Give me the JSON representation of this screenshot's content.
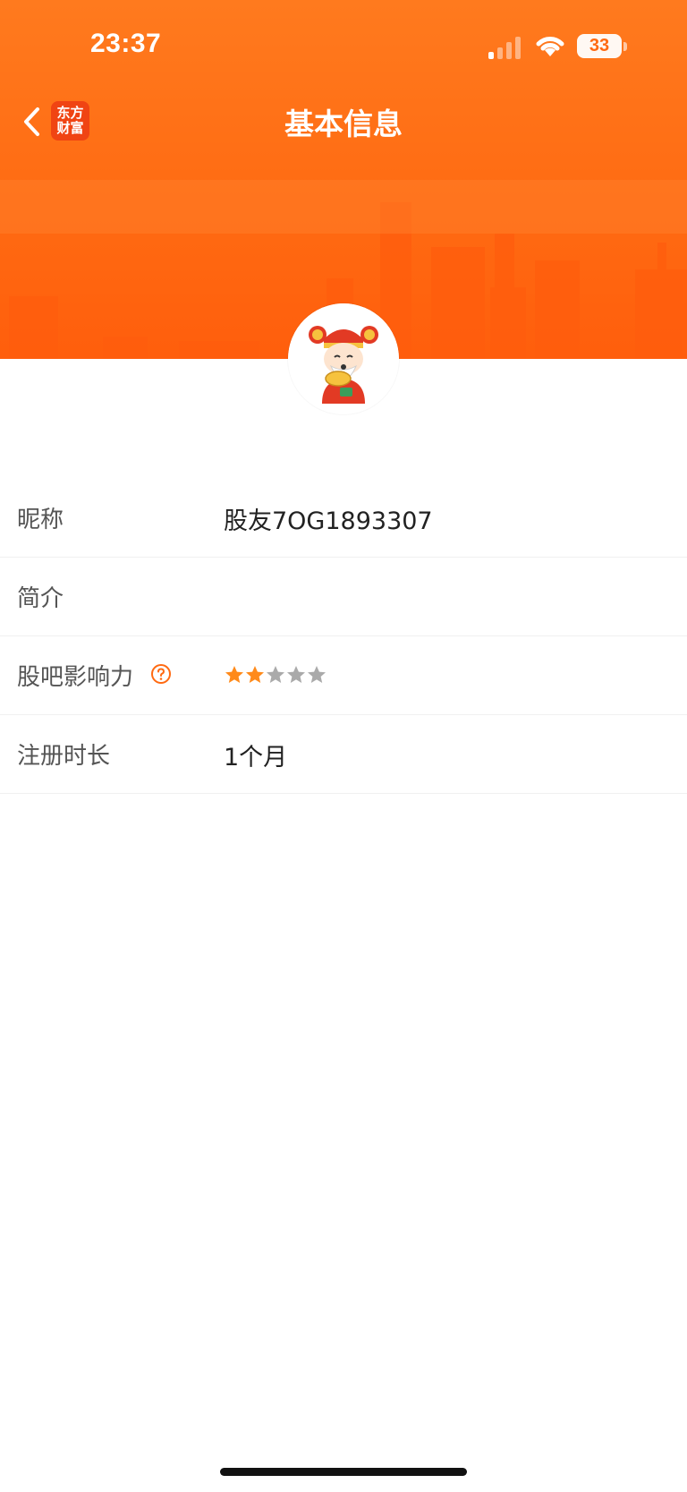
{
  "status_bar": {
    "time": "23:37",
    "battery": "33"
  },
  "nav": {
    "title": "基本信息",
    "logo_line1": "东方",
    "logo_line2": "财富"
  },
  "colors": {
    "brand_orange": "#ff6a12",
    "star_filled": "#ff8a1a",
    "star_empty": "#aaaaaa"
  },
  "profile": {
    "rows": [
      {
        "label": "昵称",
        "value": "股友7OG1893307"
      },
      {
        "label": "简介",
        "value": ""
      },
      {
        "label": "股吧影响力",
        "value": ""
      },
      {
        "label": "注册时长",
        "value": "1个月"
      }
    ],
    "influence_rating": 2,
    "influence_max": 5
  },
  "icons": [
    "back-chevron-icon",
    "signal-icon",
    "wifi-icon",
    "help-circle-icon",
    "star-icon",
    "caishen-avatar"
  ]
}
